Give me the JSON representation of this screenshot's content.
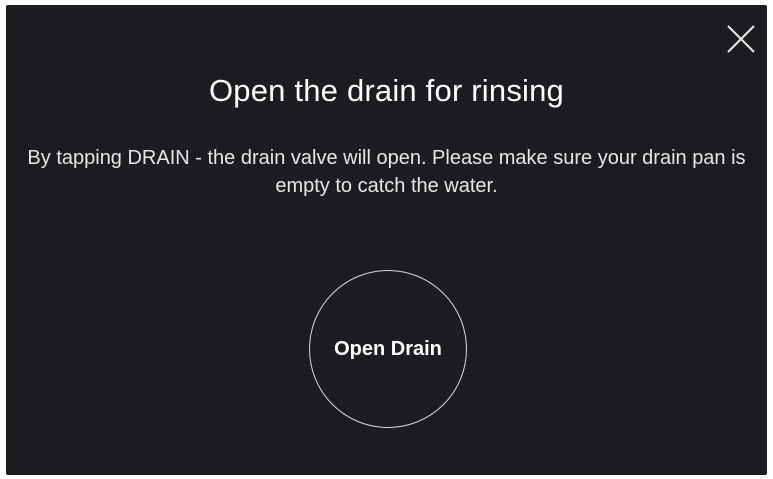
{
  "dialog": {
    "title": "Open the drain for rinsing",
    "message": "By tapping DRAIN - the drain valve will open. Please make sure your drain pan is empty to catch the water.",
    "close_icon": "close-icon",
    "action_label": "Open Drain"
  },
  "colors": {
    "background": "#1c1d21",
    "text": "#ffffff",
    "button_border": "#d8d8d8"
  }
}
